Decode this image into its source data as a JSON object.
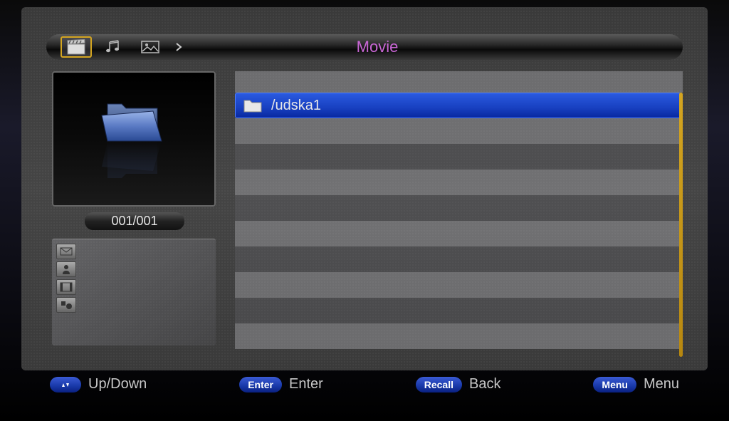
{
  "header": {
    "title": "Movie",
    "tabs": [
      {
        "name": "movie",
        "active": true
      },
      {
        "name": "music",
        "active": false
      },
      {
        "name": "photo",
        "active": false
      }
    ]
  },
  "preview": {
    "counter": "001/001"
  },
  "list": {
    "items": [
      {
        "label": "/udska1",
        "type": "folder",
        "selected": true
      }
    ]
  },
  "buttons": {
    "updown": {
      "pill": "▲▼",
      "label": "Up/Down"
    },
    "enter": {
      "pill": "Enter",
      "label": "Enter"
    },
    "back": {
      "pill": "Recall",
      "label": "Back"
    },
    "menu": {
      "pill": "Menu",
      "label": "Menu"
    }
  }
}
